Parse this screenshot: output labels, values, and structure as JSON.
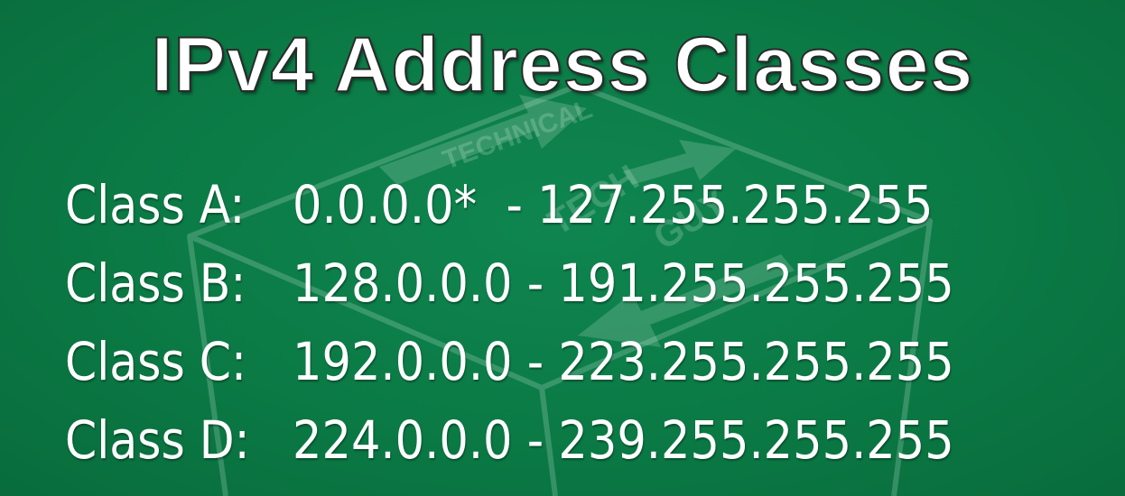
{
  "title": "IPv4 Address Classes",
  "classes": [
    {
      "label": "Class A:",
      "range": "0.0.0.0*  - 127.255.255.255"
    },
    {
      "label": "Class B:",
      "range": "128.0.0.0 - 191.255.255.255"
    },
    {
      "label": "Class C:",
      "range": "192.0.0.0 - 223.255.255.255"
    },
    {
      "label": "Class D:",
      "range": "224.0.0.0 - 239.255.255.255"
    }
  ],
  "watermark": {
    "icon": "network-switch-arrows-icon",
    "text_top": "TECH",
    "text_bottom": "GUY",
    "text_side": "TECHNICAL"
  },
  "colors": {
    "background": "#0b7a45",
    "text": "#ffffff"
  }
}
